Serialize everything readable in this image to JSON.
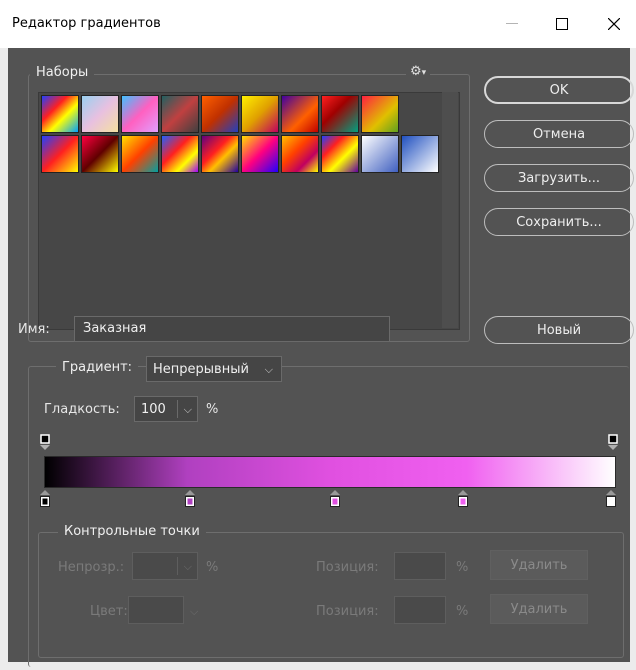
{
  "window": {
    "title": "Редактор градиентов"
  },
  "presets": {
    "legend": "Наборы",
    "gear_icon": "gear-icon"
  },
  "buttons": {
    "ok": "OK",
    "cancel": "Отмена",
    "load": "Загрузить...",
    "save": "Сохранить...",
    "new": "Новый"
  },
  "name": {
    "label": "Имя:",
    "value": "Заказная"
  },
  "gradient": {
    "type_label": "Градиент:",
    "type_value": "Непрерывный",
    "smoothness_label": "Гладкость:",
    "smoothness_value": "100",
    "percent": "%",
    "colors": [
      "#000000",
      "#b040c0",
      "#e050e0",
      "#f060f0",
      "#ffffff"
    ]
  },
  "stops": {
    "legend": "Контрольные точки",
    "opacity_label": "Непрозр.:",
    "color_label": "Цвет:",
    "position_label": "Позиция:",
    "percent": "%",
    "delete_label": "Удалить"
  }
}
